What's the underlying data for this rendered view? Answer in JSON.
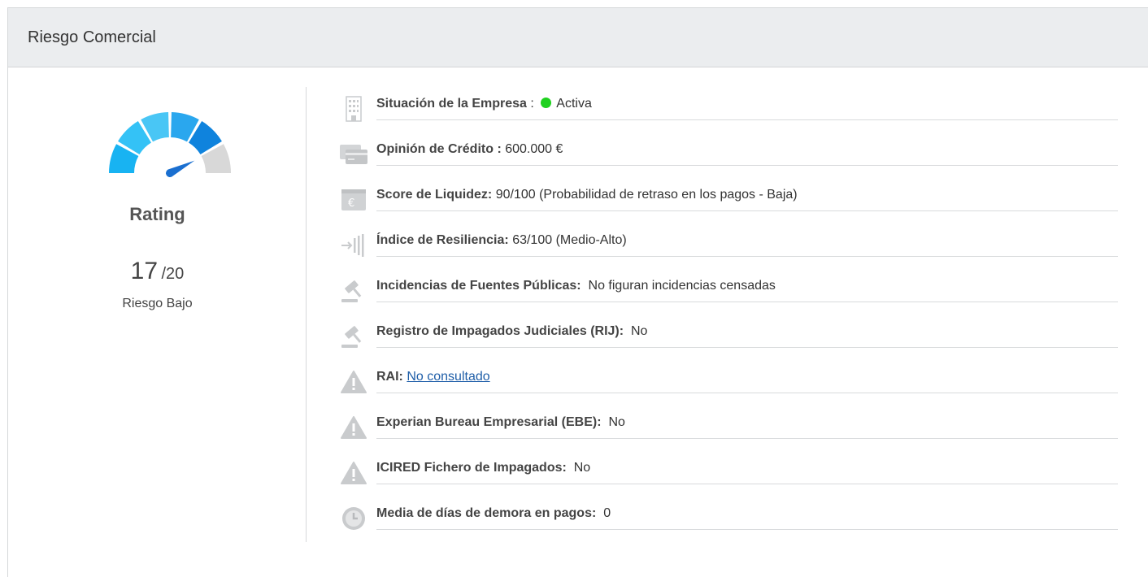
{
  "panel": {
    "title": "Riesgo Comercial"
  },
  "rating": {
    "label": "Rating",
    "value": "17",
    "max": "/20",
    "risk_level": "Riesgo Bajo",
    "score_fraction": 0.85,
    "gauge_colors": [
      "#18b3f2",
      "#34c2f6",
      "#49c6f5",
      "#2aa7ee",
      "#0f83dd",
      "#d8d8d8"
    ],
    "needle_color": "#1a6fd0"
  },
  "items": [
    {
      "icon": "building-icon",
      "label": "Situación de la Empresa",
      "sep": " : ",
      "status_color": "#1fd11f",
      "value": "Activa"
    },
    {
      "icon": "credit-card-icon",
      "label": "Opinión de Crédito :",
      "value": "600.000 €"
    },
    {
      "icon": "euro-wallet-icon",
      "label": "Score de Liquidez:",
      "value": "90/100 (Probabilidad de retraso en los pagos - Baja)"
    },
    {
      "icon": "resilience-icon",
      "label": "Índice de Resiliencia:",
      "value": "63/100 (Medio-Alto)"
    },
    {
      "icon": "gavel-icon",
      "label": "Incidencias de Fuentes Públicas:",
      "value": "No figuran incidencias censadas"
    },
    {
      "icon": "gavel-icon",
      "label": "Registro de Impagados Judiciales (RIJ):",
      "value": "No"
    },
    {
      "icon": "warning-icon",
      "label": "RAI:",
      "link": "No consultado"
    },
    {
      "icon": "warning-icon",
      "label": "Experian Bureau Empresarial (EBE):",
      "value": "No"
    },
    {
      "icon": "warning-icon",
      "label": "ICIRED Fichero de Impagados:",
      "value": "No"
    },
    {
      "icon": "clock-icon",
      "label": "Media de días de demora en pagos:",
      "value": "0"
    }
  ]
}
